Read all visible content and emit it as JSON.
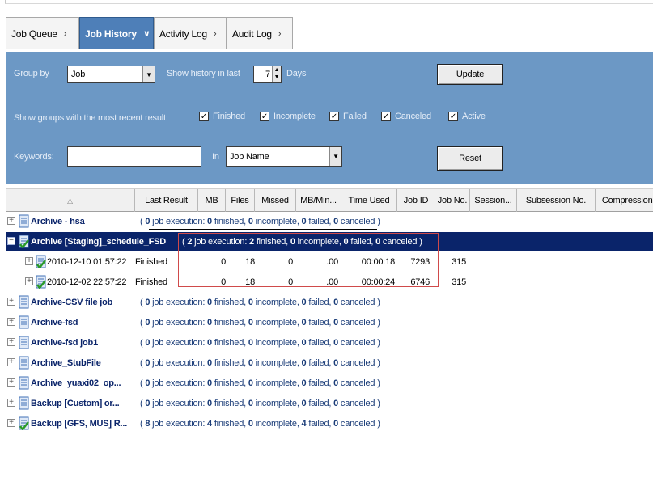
{
  "tabs": [
    {
      "label": "Job Queue",
      "chevron": "›",
      "active": false
    },
    {
      "label": "Job History",
      "chevron": "∨",
      "active": true
    },
    {
      "label": "Activity Log",
      "chevron": "›",
      "active": false
    },
    {
      "label": "Audit Log",
      "chevron": "›",
      "active": false
    }
  ],
  "filters": {
    "group_by_label": "Group by",
    "group_by_value": "Job",
    "show_history_label": "Show history in last",
    "days_value": "7",
    "days_label": "Days",
    "update_button": "Update",
    "show_groups_label": "Show groups with the most recent result:",
    "checkboxes": [
      {
        "label": "Finished",
        "checked": true
      },
      {
        "label": "Incomplete",
        "checked": true
      },
      {
        "label": "Failed",
        "checked": true
      },
      {
        "label": "Canceled",
        "checked": true
      },
      {
        "label": "Active",
        "checked": true
      }
    ],
    "keywords_label": "Keywords:",
    "keywords_value": "",
    "in_label": "In",
    "in_value": "Job Name",
    "reset_button": "Reset"
  },
  "columns": [
    "",
    "Last Result",
    "MB",
    "Files",
    "Missed",
    "MB/Min...",
    "Time Used",
    "Job ID",
    "Job No.",
    "Session...",
    "Subsession No.",
    "Compression R"
  ],
  "rows": [
    {
      "type": "group",
      "name": "Archive - hsa",
      "summary": {
        "jobs": "0",
        "finished": "0",
        "incomplete": "0",
        "failed": "0",
        "canceled": "0"
      },
      "icon": "plain",
      "selected": false
    },
    {
      "type": "group",
      "name": "Archive [Staging]_schedule_FSD",
      "summary": {
        "jobs": "2",
        "finished": "2",
        "incomplete": "0",
        "failed": "0",
        "canceled": "0"
      },
      "icon": "check",
      "selected": true
    },
    {
      "type": "job",
      "name": "2010-12-10 01:57:22",
      "result": "Finished",
      "mb": "0",
      "files": "18",
      "missed": "0",
      "mbmin": ".00",
      "time": "00:00:18",
      "jobid": "7293",
      "jobno": "315"
    },
    {
      "type": "job",
      "name": "2010-12-02 22:57:22",
      "result": "Finished",
      "mb": "0",
      "files": "18",
      "missed": "0",
      "mbmin": ".00",
      "time": "00:00:24",
      "jobid": "6746",
      "jobno": "315"
    },
    {
      "type": "group",
      "name": "Archive-CSV file  job",
      "summary": {
        "jobs": "0",
        "finished": "0",
        "incomplete": "0",
        "failed": "0",
        "canceled": "0"
      },
      "icon": "plain",
      "selected": false
    },
    {
      "type": "group",
      "name": "Archive-fsd",
      "summary": {
        "jobs": "0",
        "finished": "0",
        "incomplete": "0",
        "failed": "0",
        "canceled": "0"
      },
      "icon": "plain",
      "selected": false
    },
    {
      "type": "group",
      "name": "Archive-fsd job1",
      "summary": {
        "jobs": "0",
        "finished": "0",
        "incomplete": "0",
        "failed": "0",
        "canceled": "0"
      },
      "icon": "plain",
      "selected": false
    },
    {
      "type": "group",
      "name": "Archive_StubFile",
      "summary": {
        "jobs": "0",
        "finished": "0",
        "incomplete": "0",
        "failed": "0",
        "canceled": "0"
      },
      "icon": "plain",
      "selected": false
    },
    {
      "type": "group",
      "name": "Archive_yuaxi02_op...",
      "summary": {
        "jobs": "0",
        "finished": "0",
        "incomplete": "0",
        "failed": "0",
        "canceled": "0"
      },
      "icon": "plain",
      "selected": false
    },
    {
      "type": "group",
      "name": "Backup [Custom] or...",
      "summary": {
        "jobs": "0",
        "finished": "0",
        "incomplete": "0",
        "failed": "0",
        "canceled": "0"
      },
      "icon": "plain",
      "selected": false
    },
    {
      "type": "group",
      "name": "Backup [GFS, MUS] R...",
      "summary": {
        "jobs": "8",
        "finished": "4",
        "incomplete": "0",
        "failed": "4",
        "canceled": "0"
      },
      "icon": "check",
      "selected": false
    }
  ],
  "summary_text": {
    "open": "( ",
    "job_execution": " job execution: ",
    "finished": " finished, ",
    "incomplete": " incomplete, ",
    "failed": " failed, ",
    "canceled": " canceled )"
  },
  "colors": {
    "panel": "#6c98c5",
    "active_tab": "#4e7fb8",
    "selection": "#0a246a",
    "highlight_box": "#d04a4a"
  }
}
